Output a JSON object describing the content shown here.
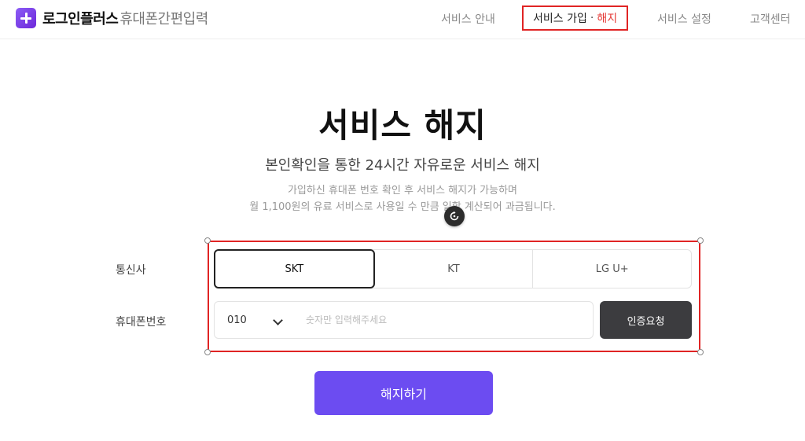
{
  "header": {
    "brand": "로그인플러스",
    "brand_sub": "휴대폰간편입력",
    "nav": {
      "guide": "서비스 안내",
      "join": "서비스 가입",
      "join_sep": "·",
      "cancel": "해지",
      "settings": "서비스 설정",
      "support": "고객센터"
    }
  },
  "hero": {
    "title": "서비스 해지",
    "subtitle": "본인확인을 통한 24시간 자유로운 서비스 해지",
    "desc_line1": "가입하신 휴대폰 번호 확인 후 서비스 해지가 가능하며",
    "desc_line2": "월 1,100원의 유료 서비스로 사용일 수 만큼 일할 계산되어 과금됩니다."
  },
  "form": {
    "carrier_label": "통신사",
    "carriers": [
      "SKT",
      "KT",
      "LG U+"
    ],
    "selected_carrier": "SKT",
    "phone_label": "휴대폰번호",
    "phone_prefix": "010",
    "phone_placeholder": "숫자만 입력해주세요",
    "phone_value": "",
    "verify_button": "인증요청",
    "submit_button": "해지하기"
  },
  "colors": {
    "accent": "#6c4cf1",
    "highlight_border": "#e02424",
    "cancel_text": "#e53935",
    "verify_bg": "#3c3c3f"
  },
  "icons": {
    "logo": "plus-logo-icon",
    "prefix_dropdown": "chevron-down-icon",
    "rotate": "rotate-icon"
  }
}
